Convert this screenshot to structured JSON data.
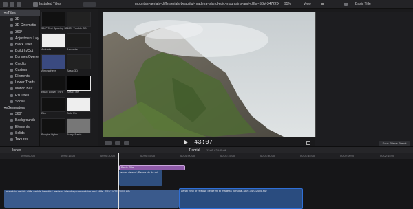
{
  "toolbar": {
    "library_label": "Installed Titles",
    "clip_title": "mountain-aerials-cliffs-aerials-beautiful-madeira-island-epic-mountains-and-cliffs--SBV-34722005...",
    "zoom": "95%",
    "view_label": "View",
    "inspector_title": "Basic Title"
  },
  "sidebar": {
    "items": [
      {
        "label": "Titles",
        "group": true,
        "selected": true
      },
      {
        "label": "3D",
        "group": false
      },
      {
        "label": "3D Cinematic",
        "group": false
      },
      {
        "label": "360°",
        "group": false
      },
      {
        "label": "Adjustment Lay...",
        "group": false
      },
      {
        "label": "Block Titles",
        "group": false
      },
      {
        "label": "Build In/Out",
        "group": false
      },
      {
        "label": "Bumper/Opener",
        "group": false
      },
      {
        "label": "Credits",
        "group": false
      },
      {
        "label": "Custom",
        "group": false
      },
      {
        "label": "Elements",
        "group": false
      },
      {
        "label": "Lower Thirds",
        "group": false
      },
      {
        "label": "Motion Blur",
        "group": false
      },
      {
        "label": "RN Titles",
        "group": false
      },
      {
        "label": "Social",
        "group": false
      },
      {
        "label": "Generators",
        "group": true
      },
      {
        "label": "360°",
        "group": false
      },
      {
        "label": "Backgrounds",
        "group": false
      },
      {
        "label": "Elements",
        "group": false
      },
      {
        "label": "Solids",
        "group": false
      },
      {
        "label": "Textures",
        "group": false
      }
    ]
  },
  "browser": {
    "thumbs": [
      {
        "label": "360° Text Spacing 3D",
        "col": 0
      },
      {
        "label": "360° Tumble 3D",
        "col": 1
      },
      {
        "label": "Activate",
        "col": 0
      },
      {
        "label": "Ascender",
        "col": 1
      },
      {
        "label": "Atmosphere",
        "col": 0
      },
      {
        "label": "Basic 3D",
        "col": 1
      },
      {
        "label": "Basic Lower Third",
        "col": 0
      },
      {
        "label": "Basic Title",
        "col": 1
      },
      {
        "label": "Blur",
        "col": 0
      },
      {
        "label": "Bold Fin",
        "col": 1
      },
      {
        "label": "Boogie Lights",
        "col": 0
      },
      {
        "label": "Bump Basic",
        "col": 1
      }
    ]
  },
  "viewer": {
    "timecode": "43:07"
  },
  "timeline": {
    "index_label": "Index",
    "project_label": "Tutorial",
    "duration": "12:01 / 24:05:06",
    "title_clip_label": "Basic Title",
    "clip_label_upper": "aerial view of (Reuse de de mi...",
    "clip_label_main": "mountain-aerials-cliffs-aerials-beautiful-madeira-island-epic-mountains-and-cliffs--SBV-347220055-HD",
    "clip_label_right": "aerial view of (Reuse de de mi el madeira portugal-SBV-34722405-HD",
    "ruler_marks": [
      "00:00:00:00",
      "00:00:15:00",
      "00:00:30:00",
      "00:00:45:00",
      "00:01:00:00",
      "00:01:15:00",
      "00:01:30:00",
      "00:01:45:00",
      "00:02:00:00",
      "00:02:15:00"
    ]
  },
  "inspector": {
    "save_preset": "Save Effects Preset"
  },
  "colors": {
    "accent": "#f0c000",
    "title_clip": "#8e5aa8",
    "video_clip": "#3a5a8c",
    "selection": "#2f6fd6"
  }
}
